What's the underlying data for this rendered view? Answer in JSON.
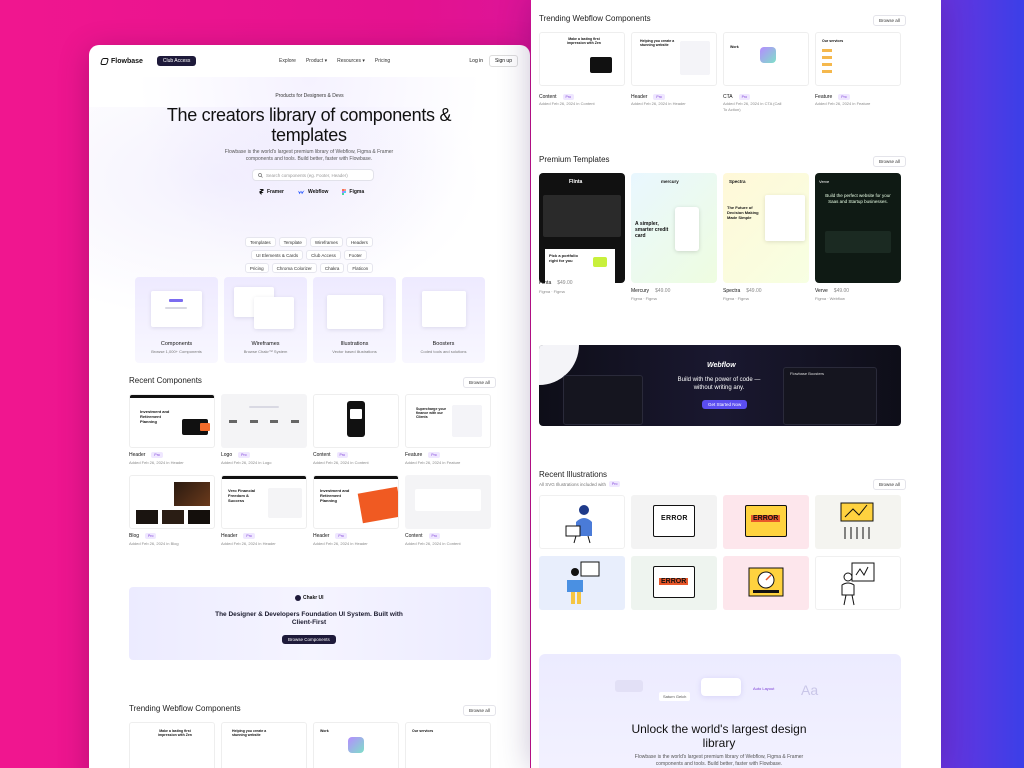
{
  "nav": {
    "brand": "Flowbase",
    "club_label": "Club Access",
    "links": [
      "Explore",
      "Product ▾",
      "Resources ▾",
      "Pricing"
    ],
    "login": "Log in",
    "signup": "Sign up"
  },
  "hero": {
    "kicker": "Products for Designers & Devs",
    "title": "The creators library of components & templates",
    "subtitle": "Flowbase is the world's largest premium library of Webflow, Figma & Framer components and tools. Build better, faster with Flowbase.",
    "search_placeholder": "Search components (eg. Footer, Header)",
    "tools": [
      "Framer",
      "Webflow",
      "Figma"
    ],
    "chips": [
      "Templates",
      "Template",
      "Wireframes",
      "Headers",
      "UI Elements & Cards",
      "Club Access",
      "Footer",
      "Pricing",
      "Chroma Colorizer",
      "Chakra",
      "Flaticon"
    ]
  },
  "categories": [
    {
      "title": "Components",
      "sub": "Browse 1,000+ Components"
    },
    {
      "title": "Wireframes",
      "sub": "Browse Chakr™ System"
    },
    {
      "title": "Illustrations",
      "sub": "Vector based illustrations"
    },
    {
      "title": "Boosters",
      "sub": "Coded tools and solutions"
    }
  ],
  "recent": {
    "title": "Recent Components",
    "browse": "Browse all",
    "cards": [
      {
        "name": "Header",
        "badge": "Pro",
        "date": "Added Feb 26, 2024 in Header"
      },
      {
        "name": "Logo",
        "badge": "Pro",
        "date": "Added Feb 26, 2024 in Logo"
      },
      {
        "name": "Content",
        "badge": "Pro",
        "date": "Added Feb 26, 2024 in Content"
      },
      {
        "name": "Feature",
        "badge": "Pro",
        "date": "Added Feb 26, 2024 in Feature"
      },
      {
        "name": "Blog",
        "badge": "Pro",
        "date": "Added Feb 26, 2024 in Blog"
      },
      {
        "name": "Header",
        "badge": "Pro",
        "date": "Added Feb 26, 2024 in Header"
      },
      {
        "name": "Header",
        "badge": "Pro",
        "date": "Added Feb 26, 2024 in Header"
      },
      {
        "name": "Content",
        "badge": "Pro",
        "date": "Added Feb 26, 2024 in Content"
      }
    ],
    "thumb_texts": [
      "Investment and Retirement Planning",
      "Supercharge your finance with our Clients",
      "Vero Financial Freedom & Success",
      "Investment and Retirement Planning"
    ]
  },
  "chakra_banner": {
    "logo": "Chakr UI",
    "title": "The Designer & Developers Foundation UI System. Built with Client-First",
    "button": "Browse Components"
  },
  "trending_left": {
    "title": "Trending Webflow Components",
    "browse": "Browse all",
    "thumb_texts": [
      "Make a lasting first impression with Zen",
      "Helping you create a stunning website",
      "Work",
      "Our services"
    ]
  },
  "trending_right": {
    "title": "Trending Webflow Components",
    "browse": "Browse all",
    "cards": [
      {
        "name": "Content",
        "badge": "Pro",
        "date": "Added Feb 26, 2024 in Content"
      },
      {
        "name": "Header",
        "badge": "Pro",
        "date": "Added Feb 26, 2024 in Header"
      },
      {
        "name": "CTA",
        "badge": "Pro",
        "date": "Added Feb 26, 2024 in CTA (Call To Action)"
      },
      {
        "name": "Feature",
        "badge": "Pro",
        "date": "Added Feb 26, 2024 in Feature"
      }
    ]
  },
  "premium": {
    "title": "Premium Templates",
    "browse": "Browse all",
    "templates": [
      {
        "name": "Flinta",
        "price": "$49.00",
        "platform": "Figma · Figma",
        "thumb_title": "Flinta",
        "thumb_text": "Pick a portfolio right for you"
      },
      {
        "name": "Mercury",
        "price": "$49.00",
        "platform": "Figma · Figma",
        "thumb_title": "mercury",
        "thumb_text": "A simpler, smarter credit card"
      },
      {
        "name": "Spectra",
        "price": "$49.00",
        "platform": "Figma · Figma",
        "thumb_title": "Spectra",
        "thumb_text": "The Future of Decision Making Made Simple"
      },
      {
        "name": "Verve",
        "price": "$49.00",
        "platform": "Figma · Webflow",
        "thumb_title": "Verve",
        "thumb_text": "Build the perfect website for your Saas and Startup businesses."
      }
    ]
  },
  "webflow_banner": {
    "logo": "Webflow",
    "title": "Build with the power of code — without writing any.",
    "button": "Get Started Now",
    "side_label": "Flowbase Boosters"
  },
  "illustrations": {
    "title": "Recent Illustrations",
    "sub": "All SVG Illustrations included with",
    "badge": "Pro",
    "browse": "Browse all",
    "error_text": "ERROR",
    "bg_colors": [
      "#ffffff",
      "#f3f3f3",
      "#fde6ec",
      "#f4f4f0",
      "#e8eefc",
      "#eef4ef",
      "#fde6ec",
      "#ffffff"
    ]
  },
  "unlock": {
    "title": "Unlock the world's largest design library",
    "subtitle": "Flowbase is the world's largest premium library of Webflow, Figma & Framer components and tools. Build better, faster with Flowbase.",
    "bubble_1": "Saturn Gelch",
    "bubble_2": "Auto Layout",
    "glyph": "Aa"
  },
  "colors": {
    "accent_dark": "#1e1a3a",
    "pro_bg": "#efe7ff",
    "pro_text": "#7a3bd6",
    "webflow_btn": "#5b4ef0"
  }
}
